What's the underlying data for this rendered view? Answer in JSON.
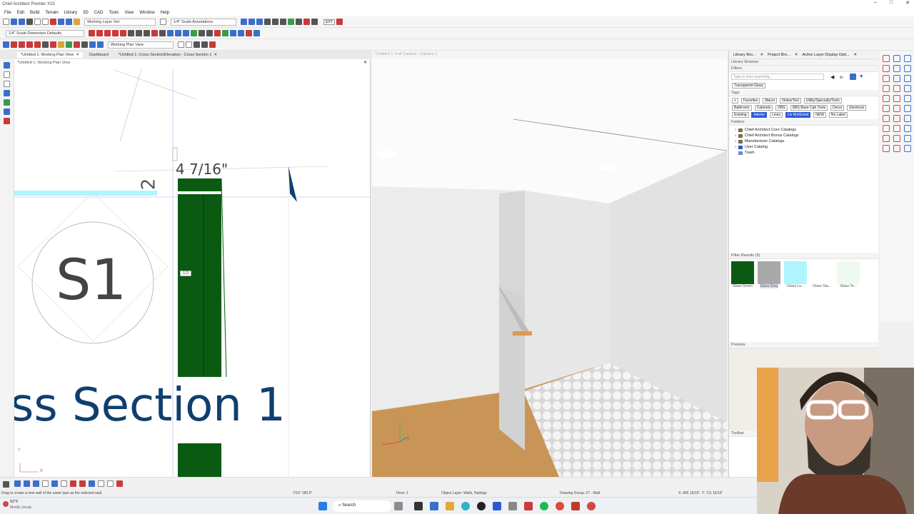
{
  "window": {
    "title": "Chief Architect Premier X15"
  },
  "menu": [
    "File",
    "Edit",
    "Build",
    "Terrain",
    "Library",
    "3D",
    "CAD",
    "Tools",
    "View",
    "Window",
    "Help"
  ],
  "toolbar": {
    "layer_set": "Working Layer Set",
    "annotation_set": "1/4\" Scale Annotations",
    "dimension_defaults": "1/4\" Scale Dimension Defaults",
    "view_select": "Working Plan View",
    "ext_label": "EXT"
  },
  "tabs": [
    {
      "label": "*Untitled 1: Working Plan View",
      "active": true
    },
    {
      "label": "Dashboard",
      "active": false
    },
    {
      "label": "*Untitled 1: Cross Section/Elevation - Cross Section 1",
      "active": false
    }
  ],
  "plan": {
    "title": "*Untitled 1: Working Plan View",
    "dimension": "4 7/16\"",
    "marker_num": "2",
    "section_label": "S1",
    "section_title": "ss Section 1",
    "small_tag": "1/2",
    "axis_y": "Y",
    "axis_x": "X"
  },
  "camera": {
    "title": "*Untitled 1: Full Camera - Camera 1",
    "axis_z": "Z",
    "axis_y": "Y"
  },
  "library": {
    "tabs": [
      "Library Bro...",
      "Project Bro...",
      "Active Layer Display Opti..."
    ],
    "title": "Library Browser",
    "filters_label": "Filters",
    "search_placeholder": "Type to start searching...",
    "filter_chip": "Transparent Glass",
    "tags_label": "Tags",
    "tags_row1": [
      "Favorites",
      "Macro",
      "Notes/Text",
      "Utility/Specialty/Tools"
    ],
    "tags_row2": [
      "Bathroom",
      "Cabinets",
      "DBS",
      "DBS Base Cab Tools",
      "Decor",
      "Electrical"
    ],
    "tags_row3": [
      "Existing",
      "Interior",
      "Lines",
      "Liv Rm/Great",
      "NEW",
      "No Label"
    ],
    "tags_row3_selected": [
      "Interior",
      "Liv Rm/Great"
    ],
    "folders_label": "Folders",
    "folders": [
      "Chief Architect Core Catalogs",
      "Chief Architect Bonus Catalogs",
      "Manufacturer Catalogs",
      "User Catalog",
      "Trash"
    ],
    "results_label": "Filter Results (5)",
    "results": [
      {
        "label": "Glass Green",
        "color": "#0b5a12"
      },
      {
        "label": "Glass Grey",
        "color": "#a9a9a9"
      },
      {
        "label": "Glass La...",
        "color": "#aef5ff"
      },
      {
        "label": "Glass Sta...",
        "color": "#ffffff"
      },
      {
        "label": "Glass Te...",
        "color": "#eefaf0"
      }
    ],
    "preview_label": "Preview",
    "toolbar_label": "Toolbar"
  },
  "status": {
    "hint": "Drag to create a new wall of the same type as the selected wall.",
    "value": "7/16\"  180.0°",
    "floor": "Floor: 1",
    "object_layer": "Object Layer: Walls, Railings",
    "drawing_group": "Drawing Group: 27 - Wall",
    "coords": "X: 465 15/16\", Y: 711 15/16\""
  },
  "taskbar": {
    "weather_temp": "52°F",
    "weather_desc": "Mostly cloudy",
    "search": "Search"
  },
  "colors": {
    "wall_green": "#0b5a12",
    "section_blue": "#0f3f6e",
    "highlight_cyan": "#aef5ff",
    "accent": "#2c5bd1"
  }
}
